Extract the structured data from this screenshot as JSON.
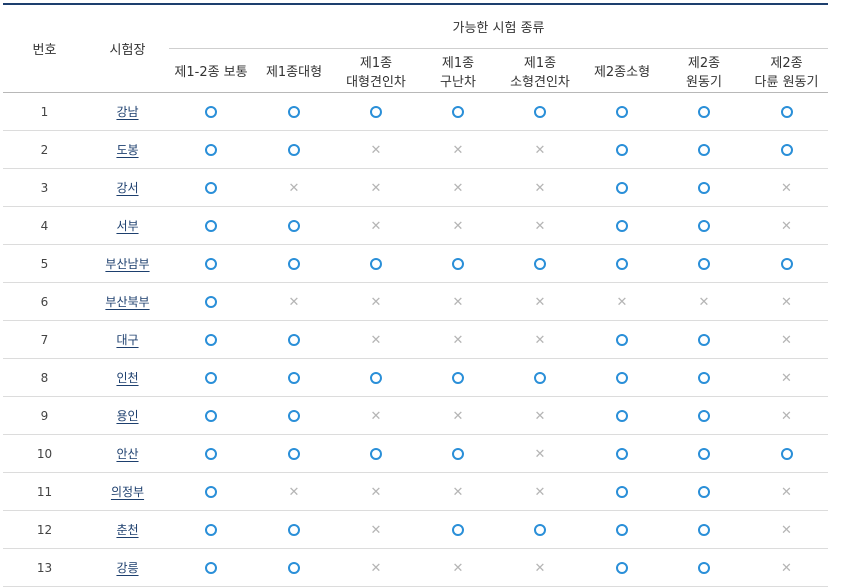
{
  "headers": {
    "number": "번호",
    "center": "시험장",
    "group": "가능한 시험 종류",
    "types": [
      [
        "제1-2종 보통"
      ],
      [
        "제1종대형"
      ],
      [
        "제1종",
        "대형견인차"
      ],
      [
        "제1종",
        "구난차"
      ],
      [
        "제1종",
        "소형견인차"
      ],
      [
        "제2종소형"
      ],
      [
        "제2종",
        "원동기"
      ],
      [
        "제2종",
        "다륜 원동기"
      ]
    ]
  },
  "symbols": {
    "available": "○",
    "unavailable": "✕"
  },
  "colors": {
    "accent": "#2a8fd8",
    "unavailable": "#b5b5b5",
    "header_line": "#1d3f6e"
  },
  "rows": [
    {
      "no": "1",
      "center": "강남",
      "avail": [
        true,
        true,
        true,
        true,
        true,
        true,
        true,
        true
      ]
    },
    {
      "no": "2",
      "center": "도봉",
      "avail": [
        true,
        true,
        false,
        false,
        false,
        true,
        true,
        true
      ]
    },
    {
      "no": "3",
      "center": "강서",
      "avail": [
        true,
        false,
        false,
        false,
        false,
        true,
        true,
        false
      ]
    },
    {
      "no": "4",
      "center": "서부",
      "avail": [
        true,
        true,
        false,
        false,
        false,
        true,
        true,
        false
      ]
    },
    {
      "no": "5",
      "center": "부산남부",
      "avail": [
        true,
        true,
        true,
        true,
        true,
        true,
        true,
        true
      ]
    },
    {
      "no": "6",
      "center": "부산북부",
      "avail": [
        true,
        false,
        false,
        false,
        false,
        false,
        false,
        false
      ]
    },
    {
      "no": "7",
      "center": "대구",
      "avail": [
        true,
        true,
        false,
        false,
        false,
        true,
        true,
        false
      ]
    },
    {
      "no": "8",
      "center": "인천",
      "avail": [
        true,
        true,
        true,
        true,
        true,
        true,
        true,
        false
      ]
    },
    {
      "no": "9",
      "center": "용인",
      "avail": [
        true,
        true,
        false,
        false,
        false,
        true,
        true,
        false
      ]
    },
    {
      "no": "10",
      "center": "안산",
      "avail": [
        true,
        true,
        true,
        true,
        false,
        true,
        true,
        true
      ]
    },
    {
      "no": "11",
      "center": "의정부",
      "avail": [
        true,
        false,
        false,
        false,
        false,
        true,
        true,
        false
      ]
    },
    {
      "no": "12",
      "center": "춘천",
      "avail": [
        true,
        true,
        false,
        true,
        true,
        true,
        true,
        false
      ]
    },
    {
      "no": "13",
      "center": "강릉",
      "avail": [
        true,
        true,
        false,
        false,
        false,
        true,
        true,
        false
      ]
    }
  ]
}
